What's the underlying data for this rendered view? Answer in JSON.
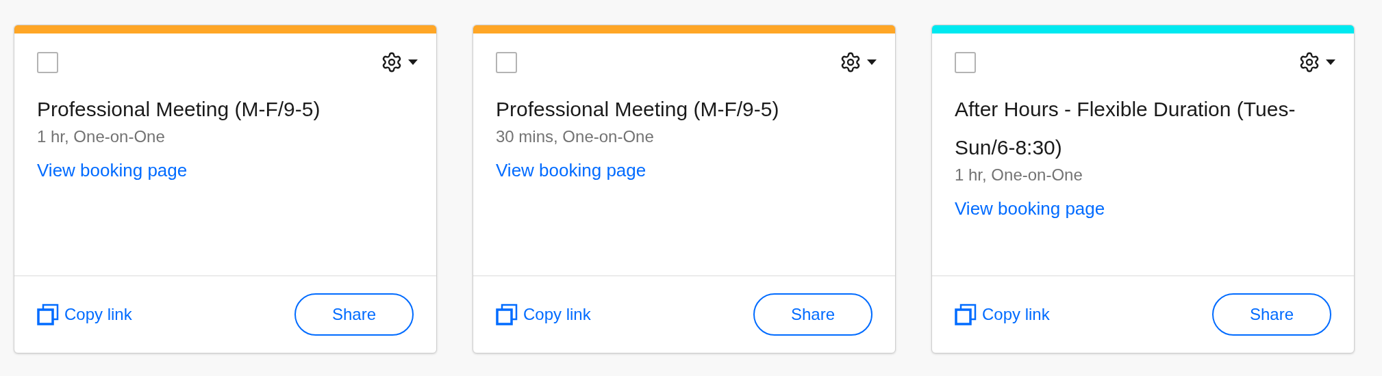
{
  "cards": [
    {
      "color": "#ffa626",
      "checked": false,
      "title": "Professional Meeting (M-F/9-5)",
      "details": "1 hr, One-on-One",
      "link": "View booking page",
      "copy_link": "Copy link",
      "share": "Share"
    },
    {
      "color": "#ffa626",
      "checked": false,
      "title": "Professional Meeting (M-F/9-5)",
      "details": "30 mins, One-on-One",
      "link": "View booking page",
      "copy_link": "Copy link",
      "share": "Share"
    },
    {
      "color": "#00e9f0",
      "checked": false,
      "title": "After Hours - Flexible Duration (Tues-Sun/6-8:30)",
      "details": "1 hr, One-on-One",
      "link": "View booking page",
      "copy_link": "Copy link",
      "share": "Share"
    }
  ]
}
